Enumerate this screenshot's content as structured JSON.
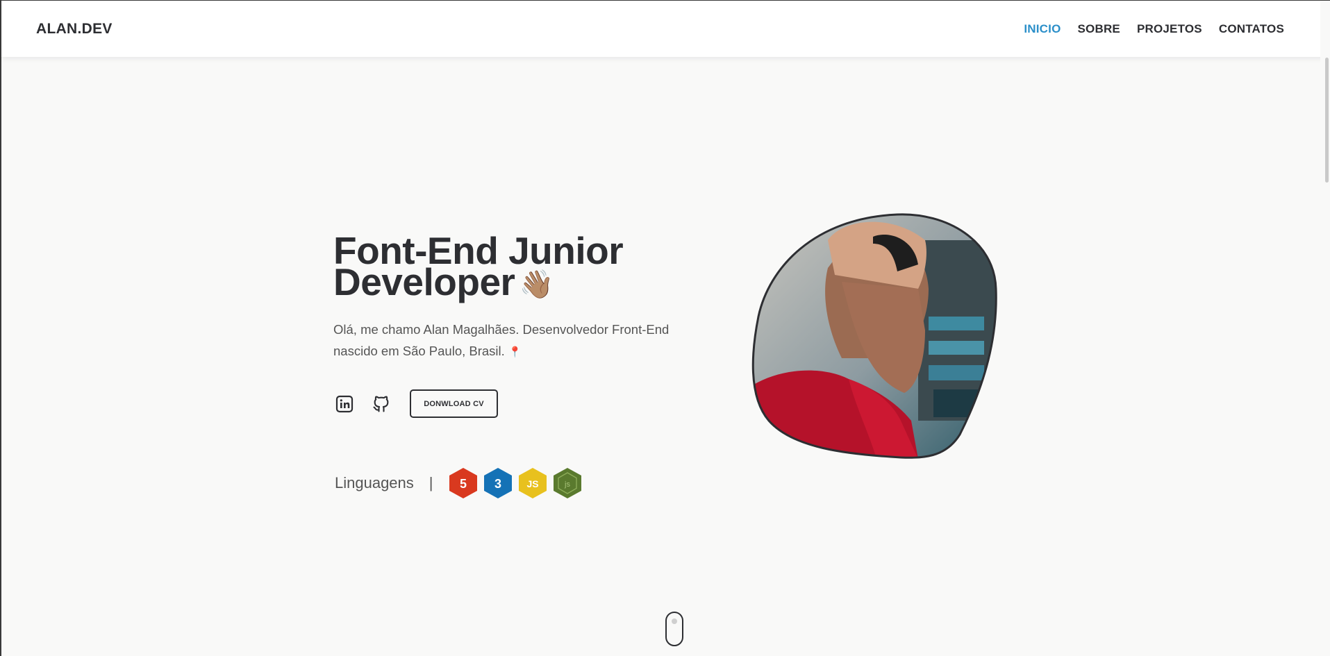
{
  "nav": {
    "brand": "ALAN.DEV",
    "links": [
      {
        "label": "INICIO",
        "active": true
      },
      {
        "label": "SOBRE",
        "active": false
      },
      {
        "label": "PROJETOS",
        "active": false
      },
      {
        "label": "CONTATOS",
        "active": false
      }
    ]
  },
  "hero": {
    "title_line1": "Font-End Junior",
    "title_line2": "Developer",
    "wave_emoji": "👋🏽",
    "description_line1": "Olá, me chamo Alan Magalhães. Desenvolvedor Front-End",
    "description_line2": "nascido em São Paulo, Brasil.",
    "pin_emoji": "📍",
    "cv_button": "DONWLOAD CV",
    "social_icons": [
      "linkedin-icon",
      "github-icon"
    ],
    "portrait_alt": "profile-photo"
  },
  "languages": {
    "label": "Linguagens",
    "separator": "|",
    "badges": [
      {
        "name": "html5",
        "color": "#e34c26",
        "glyph": "5"
      },
      {
        "name": "css3",
        "color": "#1572b6",
        "glyph": "3"
      },
      {
        "name": "javascript",
        "color": "#e8c11e",
        "glyph": "JS"
      },
      {
        "name": "nodejs",
        "color": "#5a7a2e",
        "glyph": "js"
      }
    ]
  },
  "colors": {
    "accent": "#2b8fc9",
    "text": "#2d2e32",
    "background": "#f9f9f8"
  }
}
